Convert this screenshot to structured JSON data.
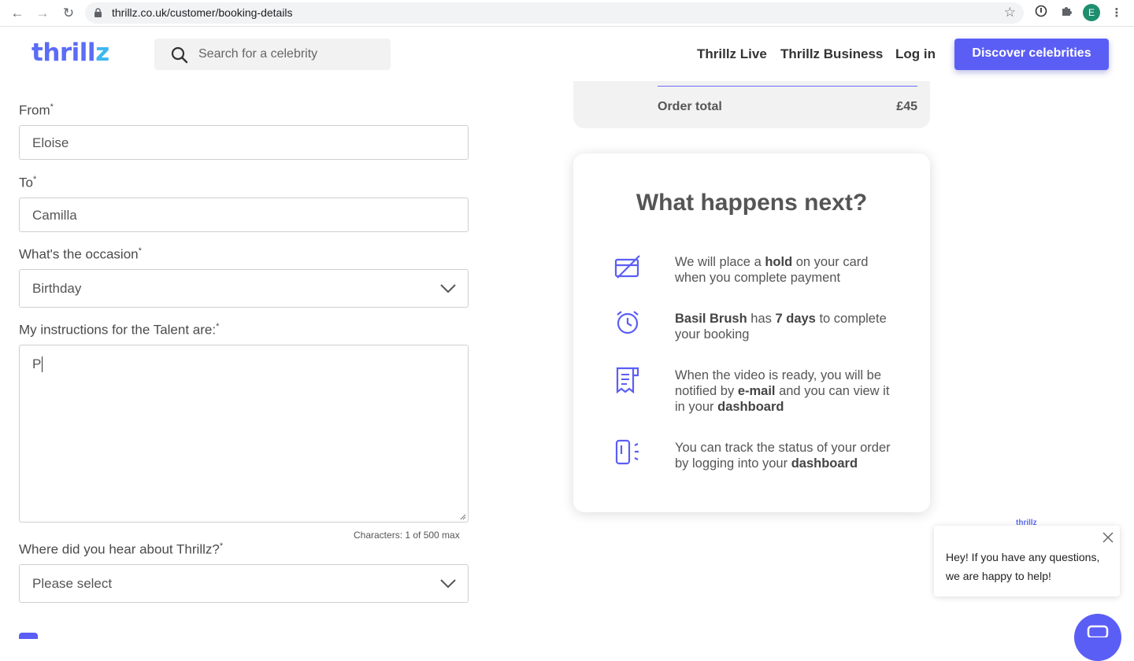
{
  "browser": {
    "url": "thrillz.co.uk/customer/booking-details",
    "profile_initial": "E",
    "icons": [
      "back-icon",
      "forward-icon",
      "reload-icon",
      "lock-icon",
      "star-icon",
      "extension-icon",
      "puzzle-icon",
      "menu-icon"
    ]
  },
  "header": {
    "logo_main": "thrill",
    "logo_z": "z",
    "search_placeholder": "Search for a celebrity",
    "nav": [
      "Thrillz Live",
      "Thrillz Business",
      "Log in"
    ],
    "cta": "Discover celebrities"
  },
  "form": {
    "from_label": "From",
    "from_value": "Eloise",
    "to_label": "To",
    "to_value": "Camilla",
    "occasion_label": "What's the occasion",
    "occasion_value": "Birthday",
    "instructions_label": "My instructions for the Talent are:",
    "instructions_value": "P",
    "char_counter": "Characters: 1 of 500 max",
    "heard_label": "Where did you hear about Thrillz?",
    "heard_value": "Please select",
    "required_mark": "*"
  },
  "order": {
    "total_label": "Order total",
    "total_value": "£45"
  },
  "next_steps": {
    "title": "What happens next?",
    "steps": [
      {
        "icon": "card-hold-icon",
        "parts": [
          "We will place a ",
          "hold",
          " on your card when you complete payment"
        ]
      },
      {
        "icon": "alarm-clock-icon",
        "parts": [
          "Basil Brush",
          " has ",
          "7 days",
          " to complete your booking"
        ]
      },
      {
        "icon": "receipt-icon",
        "parts": [
          "When the video is ready, you will be notified by ",
          "e-mail",
          " and you can view it in your ",
          "dashboard"
        ]
      },
      {
        "icon": "phone-status-icon",
        "parts": [
          "You can track the status of your order by logging into your ",
          "dashboard"
        ]
      }
    ]
  },
  "chat": {
    "brand": "thrillz",
    "message": "Hey! If you have any questions, we are happy to help!"
  },
  "colors": {
    "brand_purple": "#5b5ef5",
    "brand_blue": "#3fb6f0",
    "text": "#4a4a4a"
  }
}
